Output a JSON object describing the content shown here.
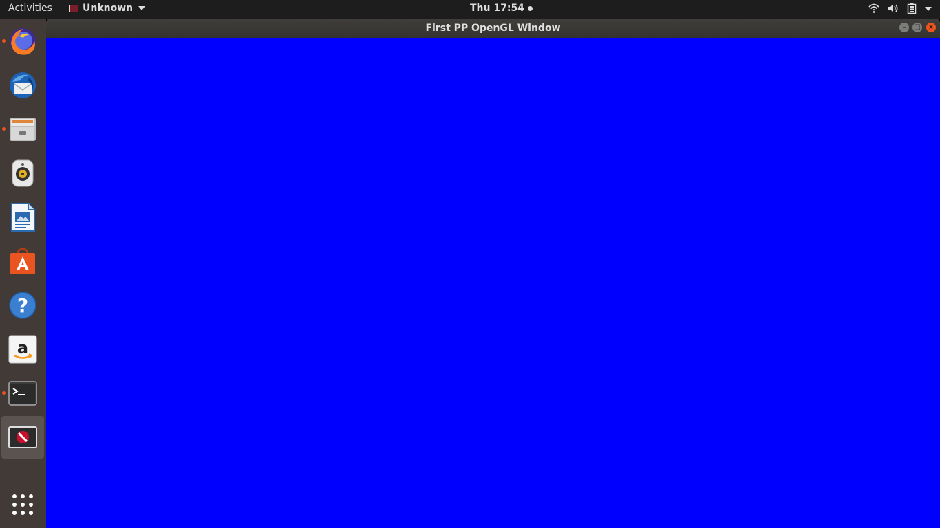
{
  "topbar": {
    "activities_label": "Activities",
    "app_menu_label": "Unknown",
    "clock": "Thu 17:54"
  },
  "window": {
    "title": "First PP OpenGL Window",
    "canvas_color": "#0000fe"
  },
  "dock": {
    "items": [
      {
        "name": "firefox",
        "running": true
      },
      {
        "name": "thunderbird",
        "running": false
      },
      {
        "name": "files",
        "running": true
      },
      {
        "name": "rhythmbox",
        "running": false
      },
      {
        "name": "libreoffice-writer",
        "running": false
      },
      {
        "name": "ubuntu-software",
        "running": false
      },
      {
        "name": "help",
        "running": false
      },
      {
        "name": "amazon",
        "running": false
      },
      {
        "name": "terminal",
        "running": true
      },
      {
        "name": "unknown-app",
        "running": true,
        "active": true
      }
    ]
  },
  "colors": {
    "accent": "#e95420",
    "dock_bg": "#413a36",
    "topbar_bg": "#1d1d1d"
  }
}
